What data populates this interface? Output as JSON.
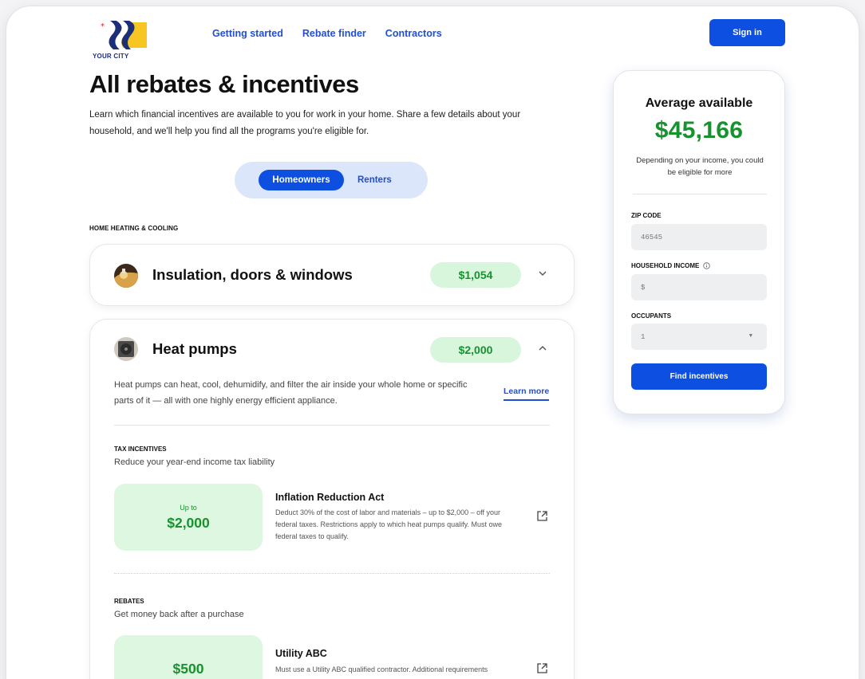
{
  "header": {
    "logo_text": "YOUR CITY",
    "nav": [
      "Getting started",
      "Rebate finder",
      "Contractors"
    ],
    "signin_label": "Sign in"
  },
  "page": {
    "title": "All rebates & incentives",
    "intro": "Learn which financial incentives are available to you for work in your home. Share a few details about your household, and we'll help you find all the programs you're eligible for.",
    "toggle": {
      "selected": "Homeowners",
      "other": "Renters"
    },
    "section_label": "HOME HEATING & COOLING"
  },
  "cards": [
    {
      "title": "Insulation, doors & windows",
      "amount": "$1,054",
      "icon": "insulation-thumbnail",
      "chevron": "chevron-down-icon"
    },
    {
      "title": "Heat pumps",
      "amount": "$2,000",
      "icon": "heat-pump-thumbnail",
      "chevron": "chevron-up-icon",
      "description": "Heat pumps can heat, cool, dehumidify, and filter the air inside your whole home or specific parts of it — all with one highly energy efficient appliance.",
      "learn_more": "Learn more",
      "tax": {
        "label": "TAX INCENTIVES",
        "desc": "Reduce your year-end income tax liability",
        "prefix": "Up to",
        "amount": "$2,000",
        "program": "Inflation Reduction Act",
        "program_desc": "Deduct 30% of the cost of labor and materials – up to $2,000 – off your federal taxes. Restrictions apply to which heat pumps qualify. Must owe federal taxes to qualify."
      },
      "rebates": {
        "label": "REBATES",
        "desc": "Get money back after a purchase",
        "amount": "$500",
        "program": "Utility ABC",
        "program_desc": "Must use a Utility ABC qualified contractor. Additional requirements"
      }
    }
  ],
  "sidebar": {
    "avg_label": "Average available",
    "avg_value": "$45,166",
    "avg_note": "Depending on your income, you could be eligible for more",
    "zip_label": "ZIP CODE",
    "zip_value": "46545",
    "income_label": "HOUSEHOLD INCOME",
    "income_placeholder": "$",
    "occupants_label": "OCCUPANTS",
    "occupants_value": "1",
    "find_label": "Find incentives"
  },
  "colors": {
    "brand_blue": "#0d4fe0",
    "link_blue": "#1f4fd6",
    "green_text": "#17922e",
    "green_fill": "#d7f6dc"
  }
}
